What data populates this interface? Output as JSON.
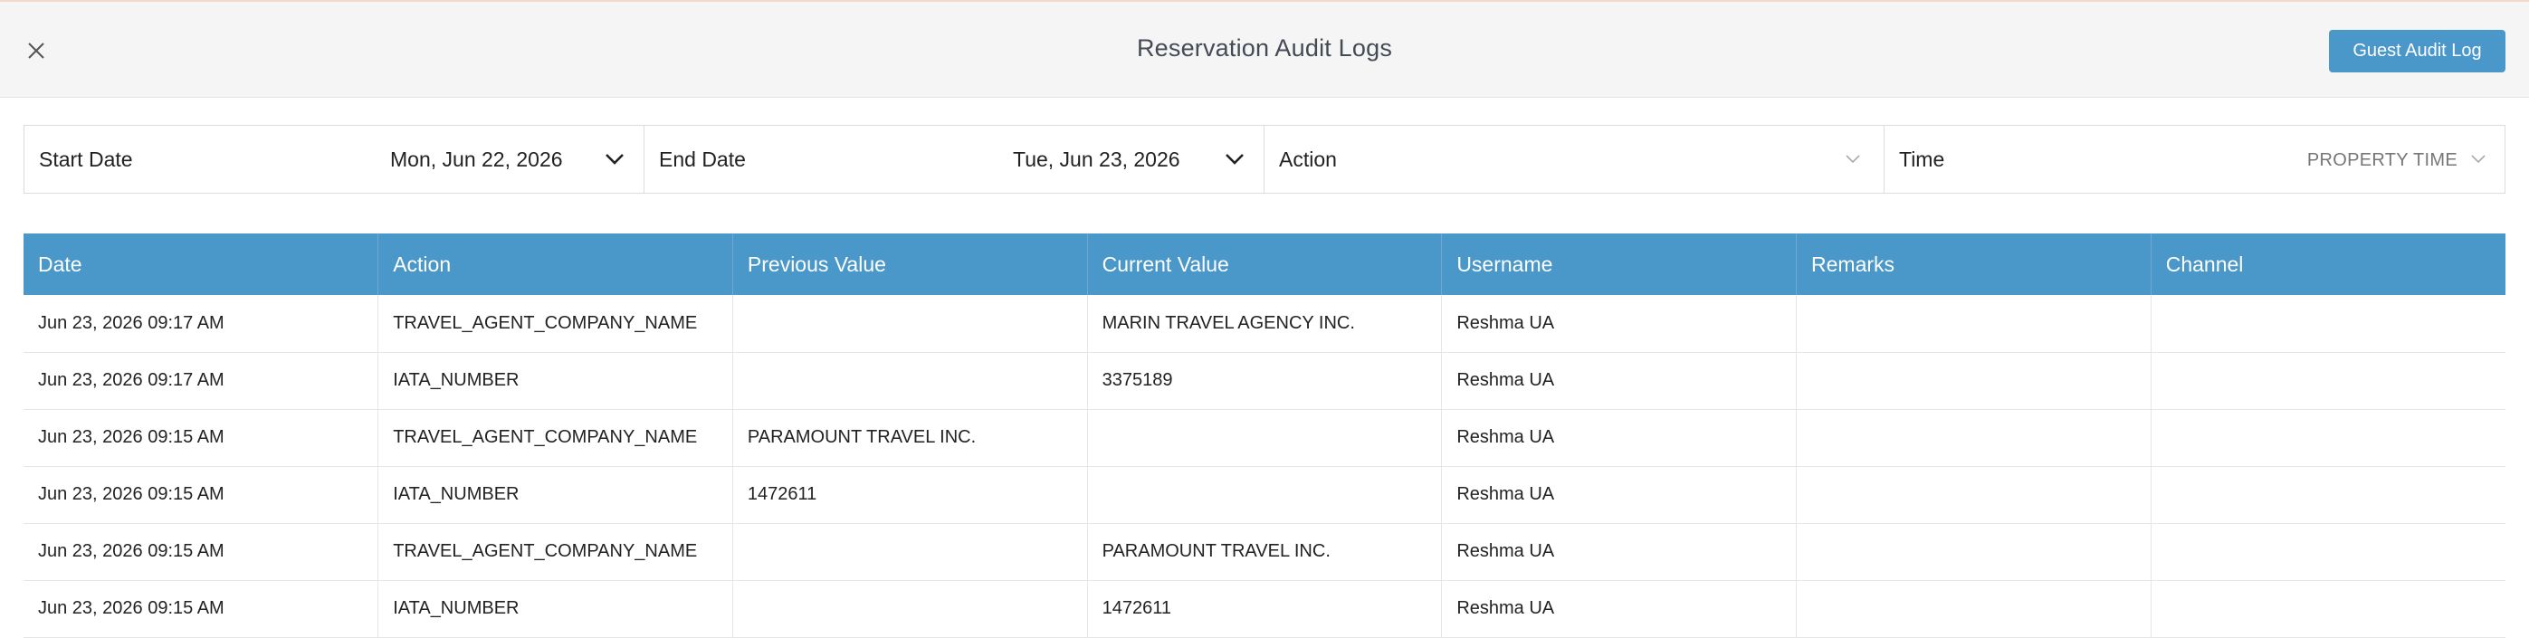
{
  "header": {
    "title": "Reservation Audit Logs",
    "guest_audit_button": "Guest Audit Log",
    "close_icon": "close-icon"
  },
  "filters": {
    "start_date": {
      "label": "Start Date",
      "value": "Mon, Jun 22, 2026"
    },
    "end_date": {
      "label": "End Date",
      "value": "Tue, Jun 23, 2026"
    },
    "action": {
      "label": "Action",
      "value": ""
    },
    "time": {
      "label": "Time",
      "value": "PROPERTY TIME"
    }
  },
  "table": {
    "columns": [
      "Date",
      "Action",
      "Previous Value",
      "Current Value",
      "Username",
      "Remarks",
      "Channel"
    ],
    "rows": [
      [
        "Jun 23, 2026 09:17 AM",
        "TRAVEL_AGENT_COMPANY_NAME",
        "",
        "MARIN TRAVEL AGENCY INC.",
        "Reshma UA",
        "",
        ""
      ],
      [
        "Jun 23, 2026 09:17 AM",
        "IATA_NUMBER",
        "",
        "3375189",
        "Reshma UA",
        "",
        ""
      ],
      [
        "Jun 23, 2026 09:15 AM",
        "TRAVEL_AGENT_COMPANY_NAME",
        "PARAMOUNT TRAVEL INC.",
        "",
        "Reshma UA",
        "",
        ""
      ],
      [
        "Jun 23, 2026 09:15 AM",
        "IATA_NUMBER",
        "1472611",
        "",
        "Reshma UA",
        "",
        ""
      ],
      [
        "Jun 23, 2026 09:15 AM",
        "TRAVEL_AGENT_COMPANY_NAME",
        "",
        "PARAMOUNT TRAVEL INC.",
        "Reshma UA",
        "",
        ""
      ],
      [
        "Jun 23, 2026 09:15 AM",
        "IATA_NUMBER",
        "",
        "1472611",
        "Reshma UA",
        "",
        ""
      ]
    ]
  },
  "colors": {
    "accent": "#4a97c9",
    "header_bg": "#f5f5f5"
  }
}
